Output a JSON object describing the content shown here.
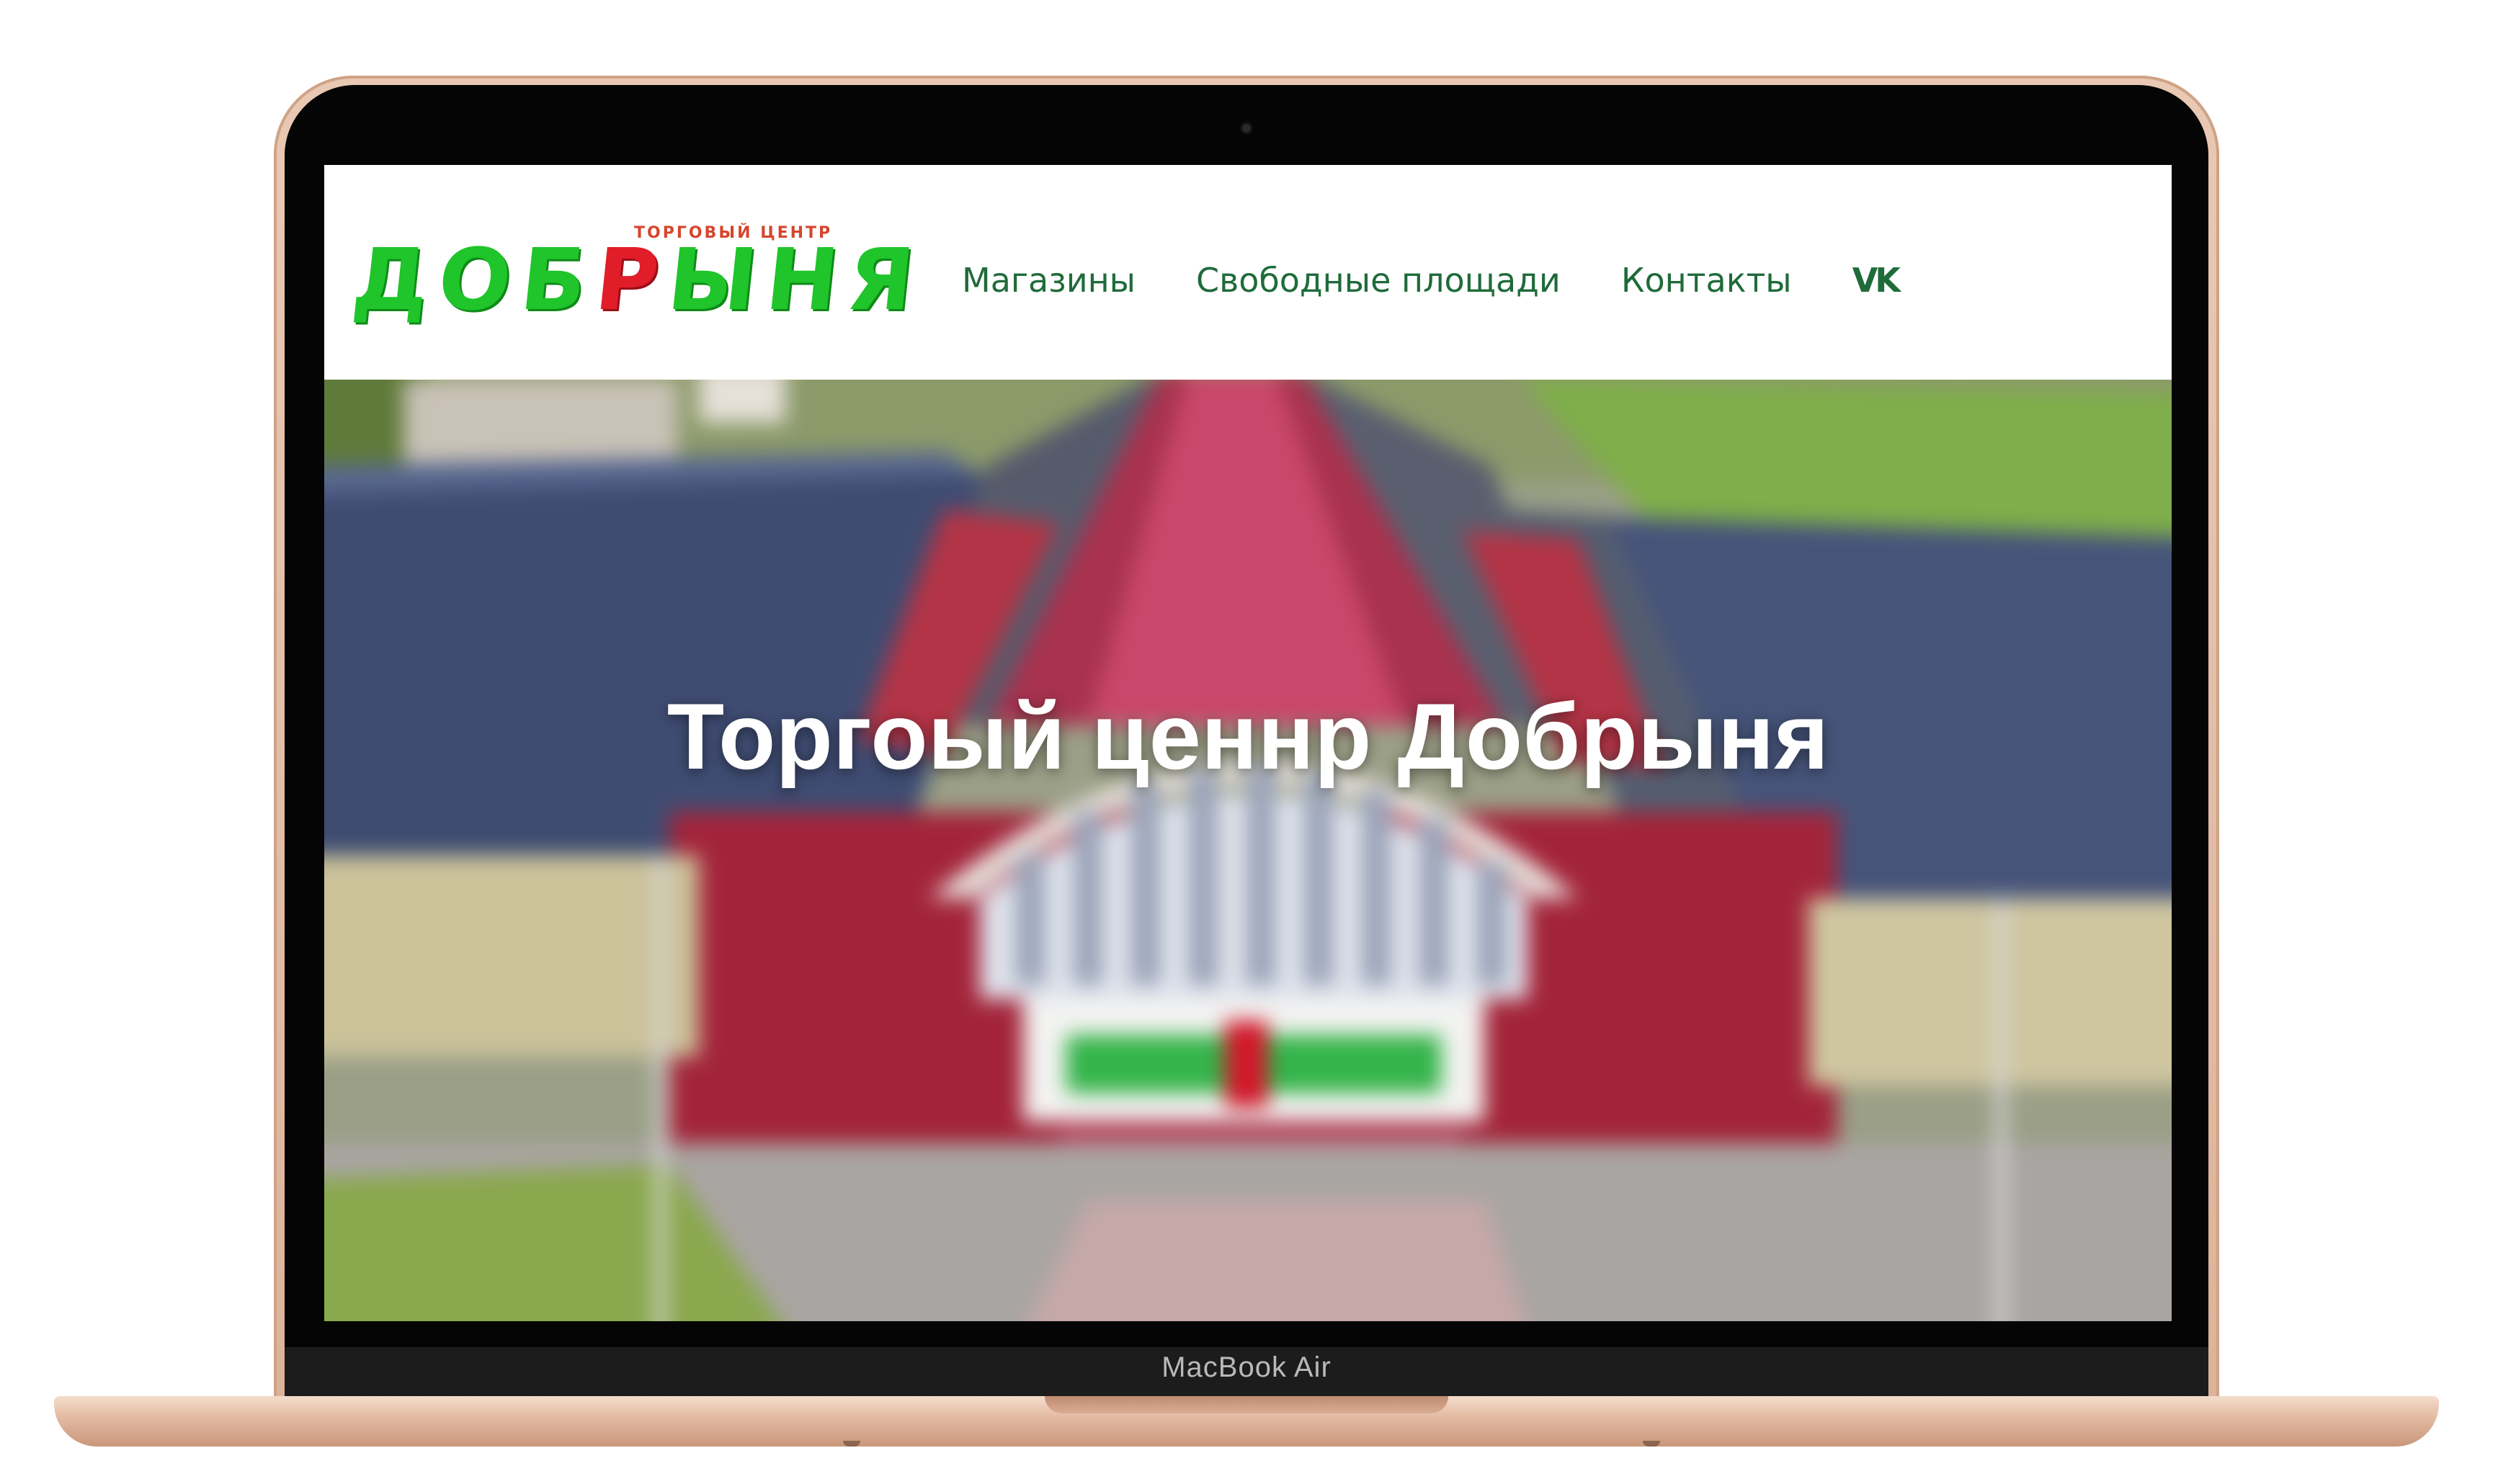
{
  "device": {
    "label": "MacBook Air"
  },
  "site": {
    "logo": {
      "subtitle": "ТОРГОВЫЙ ЦЕНТР",
      "name_part1": "ДОБ",
      "name_part2": "Р",
      "name_part3": "ЫНЯ"
    },
    "nav": {
      "items": [
        {
          "label": "Магазины"
        },
        {
          "label": "Свободные площади"
        },
        {
          "label": "Контакты"
        }
      ],
      "social_icon": "vk-icon",
      "social_label": "VK"
    },
    "hero": {
      "title": "Торгоый ценнр Добрыня"
    },
    "colors": {
      "nav_text": "#1f6b3a",
      "logo_green": "#1fc52a",
      "logo_red": "#e11d2a",
      "logo_subtitle": "#d6452d"
    }
  }
}
